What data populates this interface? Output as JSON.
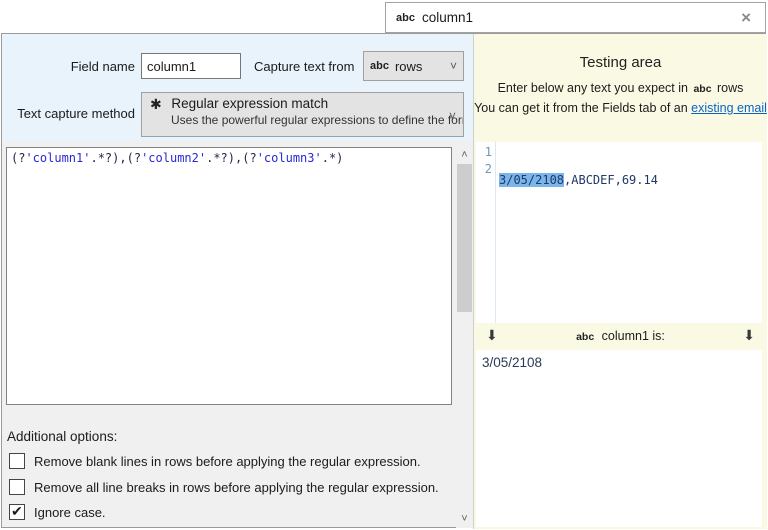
{
  "tab": {
    "badge": "abc",
    "title": "column1",
    "close_glyph": "×"
  },
  "left": {
    "field_name_label": "Field name",
    "field_name_value": "column1",
    "capture_from_label": "Capture text from",
    "capture_from": {
      "badge": "abc",
      "value": "rows",
      "chevron": "˅"
    },
    "method_label": "Text capture method",
    "method": {
      "icon_glyph": "✱",
      "title": "Regular expression match",
      "subtitle": "Uses the powerful regular expressions to define the forma",
      "chevron": "˅"
    },
    "regex_tokens": [
      {
        "t": "(?",
        "c": "p"
      },
      {
        "t": "'column1'",
        "c": "n"
      },
      {
        "t": ".*?)",
        "c": "p"
      },
      {
        "t": ",",
        "c": "p"
      },
      {
        "t": "(?",
        "c": "p"
      },
      {
        "t": "'column2'",
        "c": "n"
      },
      {
        "t": ".*?)",
        "c": "p"
      },
      {
        "t": ",",
        "c": "p"
      },
      {
        "t": "(?",
        "c": "p"
      },
      {
        "t": "'column3'",
        "c": "n"
      },
      {
        "t": ".*)",
        "c": "p"
      }
    ],
    "additional_options_label": "Additional options:",
    "options": [
      {
        "label": "Remove blank lines in rows before applying the regular expression.",
        "checked": false
      },
      {
        "label": "Remove all line breaks in rows before applying the regular expression.",
        "checked": false
      },
      {
        "label": "Ignore case.",
        "checked": true
      }
    ],
    "scrollbar": {
      "up_glyph": "˄",
      "down_glyph": "˅"
    }
  },
  "right": {
    "title": "Testing area",
    "instruction1_before": "Enter below any text you expect in",
    "instruction1_badge": "abc",
    "instruction1_after": "rows",
    "instruction2_text": "You can get it from the Fields tab of an",
    "instruction2_link": "existing email",
    "editor": {
      "line_numbers": [
        "1",
        "2"
      ],
      "line1_selected": "3/05/2108",
      "line1_rest": ",ABCDEF,69.14",
      "line2": ""
    },
    "band": {
      "arrow_glyph": "⬇",
      "badge": "abc",
      "label": "column1 is:"
    },
    "result_value": "3/05/2108"
  },
  "colors": {
    "header_blue": "#e9f3fb",
    "panel_yellow": "#fafae4",
    "pane_gray": "#f0f0f0",
    "selection_blue": "#7ab5ec",
    "regex_name_blue": "#2a2ad2",
    "link_blue": "#0a63c4"
  }
}
